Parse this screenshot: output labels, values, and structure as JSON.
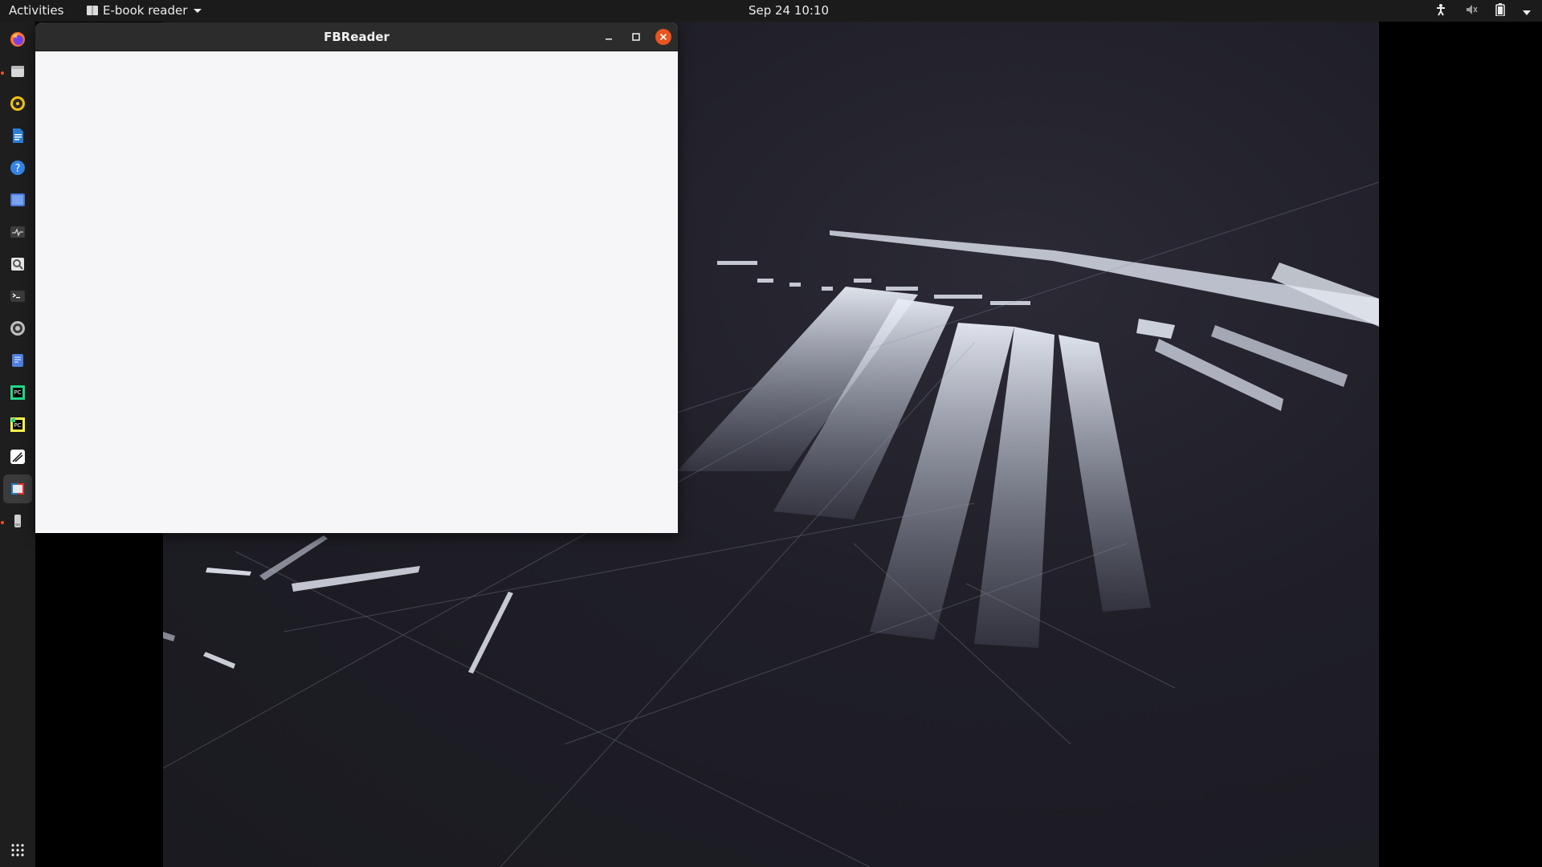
{
  "topbar": {
    "activities_label": "Activities",
    "app_menu_label": "E-book reader",
    "clock": "Sep 24  10:10"
  },
  "window": {
    "title": "FBReader"
  },
  "dock": {
    "items": [
      {
        "name": "firefox",
        "icon": "firefox-icon"
      },
      {
        "name": "files",
        "icon": "files-icon",
        "running": true
      },
      {
        "name": "rhythmbox",
        "icon": "rhythmbox-icon"
      },
      {
        "name": "libreoffice-writer",
        "icon": "writer-icon"
      },
      {
        "name": "help",
        "icon": "help-icon"
      },
      {
        "name": "screenshot",
        "icon": "screenshot-icon"
      },
      {
        "name": "system-monitor",
        "icon": "system-monitor-icon"
      },
      {
        "name": "document-viewer",
        "icon": "document-viewer-icon"
      },
      {
        "name": "terminal",
        "icon": "terminal-icon"
      },
      {
        "name": "disk-usage",
        "icon": "disk-usage-icon"
      },
      {
        "name": "notes",
        "icon": "notes-icon"
      },
      {
        "name": "pycharm",
        "icon": "pycharm-icon"
      },
      {
        "name": "pycharm-edu",
        "icon": "pycharm-edu-icon"
      },
      {
        "name": "inkscape",
        "icon": "inkscape-icon"
      },
      {
        "name": "fbreader",
        "icon": "fbreader-icon",
        "active": true
      },
      {
        "name": "usb-drive",
        "icon": "usb-drive-icon",
        "running": true
      },
      {
        "name": "show-applications",
        "icon": "app-grid-icon"
      }
    ]
  },
  "colors": {
    "accent": "#e95420",
    "topbar_bg": "#1b1b1b",
    "dock_bg": "#1e1e1e",
    "window_content_bg": "#f6f6f8",
    "titlebar_bg": "#2c2c2c"
  }
}
